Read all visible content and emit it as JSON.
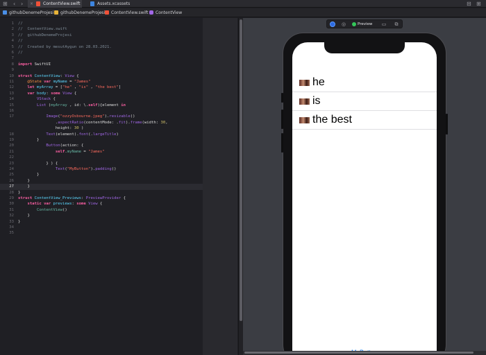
{
  "tabs": [
    {
      "label": "ContentView.swift",
      "active": true
    },
    {
      "label": "Assets.xcassets",
      "active": false
    }
  ],
  "breadcrumb": [
    "githubDenemeProjesi",
    "githubDenemeProjesi",
    "ContentView.swift",
    "ContentView"
  ],
  "editor": {
    "current_line": 27,
    "lines": [
      {
        "n": "1",
        "html": "<span class='cm'>//</span>"
      },
      {
        "n": "2",
        "html": "<span class='cm'>//  ContentView.swift</span>"
      },
      {
        "n": "3",
        "html": "<span class='cm'>//  githubDenemeProjesi</span>"
      },
      {
        "n": "4",
        "html": "<span class='cm'>//</span>"
      },
      {
        "n": "5",
        "html": "<span class='cm'>//  Created by mesutAygun on 28.03.2021.</span>"
      },
      {
        "n": "6",
        "html": "<span class='cm'>//</span>"
      },
      {
        "n": "7",
        "html": ""
      },
      {
        "n": "8",
        "html": "<span class='kw'>import</span> SwiftUI"
      },
      {
        "n": "9",
        "html": ""
      },
      {
        "n": "10",
        "html": "<span class='kw'>struct</span> <span class='ty'>ContentView</span>: <span class='pr'>View</span> {"
      },
      {
        "n": "11",
        "html": "    <span class='at'>@State</span> <span class='kw'>var</span> <span class='ty'>myName</span> = <span class='st'>\"James\"</span>"
      },
      {
        "n": "12",
        "html": "    <span class='kw'>let</span> <span class='ty'>myArray</span> = [<span class='st'>\"he\"</span> , <span class='st'>\"is\"</span> , <span class='st'>\"the best\"</span>]"
      },
      {
        "n": "13",
        "html": "    <span class='kw'>var</span> <span class='ty'>body</span>: <span class='kw'>some</span> <span class='pr'>View</span> {"
      },
      {
        "n": "14",
        "html": "        <span class='pr'>VStack</span> {"
      },
      {
        "n": "15",
        "html": "        <span class='pr'>List</span> (<span class='fn'>myArray</span> , id: \\.<span class='kw'>self</span>){element <span class='kw'>in</span>"
      },
      {
        "n": "16",
        "html": ""
      },
      {
        "n": "17",
        "html": "            <span class='pr'>Image</span>(<span class='st'>\"ozzyOsbourne.jpeg\"</span>).<span class='pr'>resizable</span>()"
      },
      {
        "n": "",
        "html": "                .<span class='pr'>aspectRatio</span>(contentMode: .<span class='pr'>fit</span>).<span class='pr'>frame</span>(width: <span class='nm'>30</span>,"
      },
      {
        "n": "",
        "html": "                height: <span class='nm'>30</span> )"
      },
      {
        "n": "18",
        "html": "            <span class='pr'>Text</span>(element).<span class='pr'>font</span>(.<span class='pr'>largeTitle</span>)"
      },
      {
        "n": "19",
        "html": "        }"
      },
      {
        "n": "20",
        "html": "            <span class='pr'>Button</span>(action: {"
      },
      {
        "n": "21",
        "html": "                <span class='kw'>self</span>.<span class='fn'>myName</span> = <span class='st'>\"James\"</span>"
      },
      {
        "n": "22",
        "html": ""
      },
      {
        "n": "23",
        "html": "            } ) {"
      },
      {
        "n": "24",
        "html": "                <span class='pr'>Text</span>(<span class='st'>\"MyButton\"</span>).<span class='pr'>padding</span>()"
      },
      {
        "n": "25",
        "html": "        }"
      },
      {
        "n": "26",
        "html": "    }"
      },
      {
        "n": "27",
        "html": "    }"
      },
      {
        "n": "28",
        "html": "}"
      },
      {
        "n": "29",
        "html": "<span class='kw'>struct</span> <span class='ty'>ContentView_Previews</span>: <span class='pr'>PreviewProvider</span> {"
      },
      {
        "n": "30",
        "html": "    <span class='kw'>static</span> <span class='kw'>var</span> <span class='ty'>previews</span>: <span class='kw'>some</span> <span class='pr'>View</span> {"
      },
      {
        "n": "31",
        "html": "        <span class='fn'>ContentView</span>()"
      },
      {
        "n": "32",
        "html": "    }"
      },
      {
        "n": "33",
        "html": "}"
      },
      {
        "n": "34",
        "html": ""
      },
      {
        "n": "35",
        "html": ""
      }
    ]
  },
  "preview": {
    "toolbar_label": "Preview",
    "list_items": [
      "he",
      "is",
      "the best"
    ],
    "button_label": "MyButton"
  },
  "colors": {
    "accent": "#147efb",
    "live_indicator": "#34c759"
  }
}
